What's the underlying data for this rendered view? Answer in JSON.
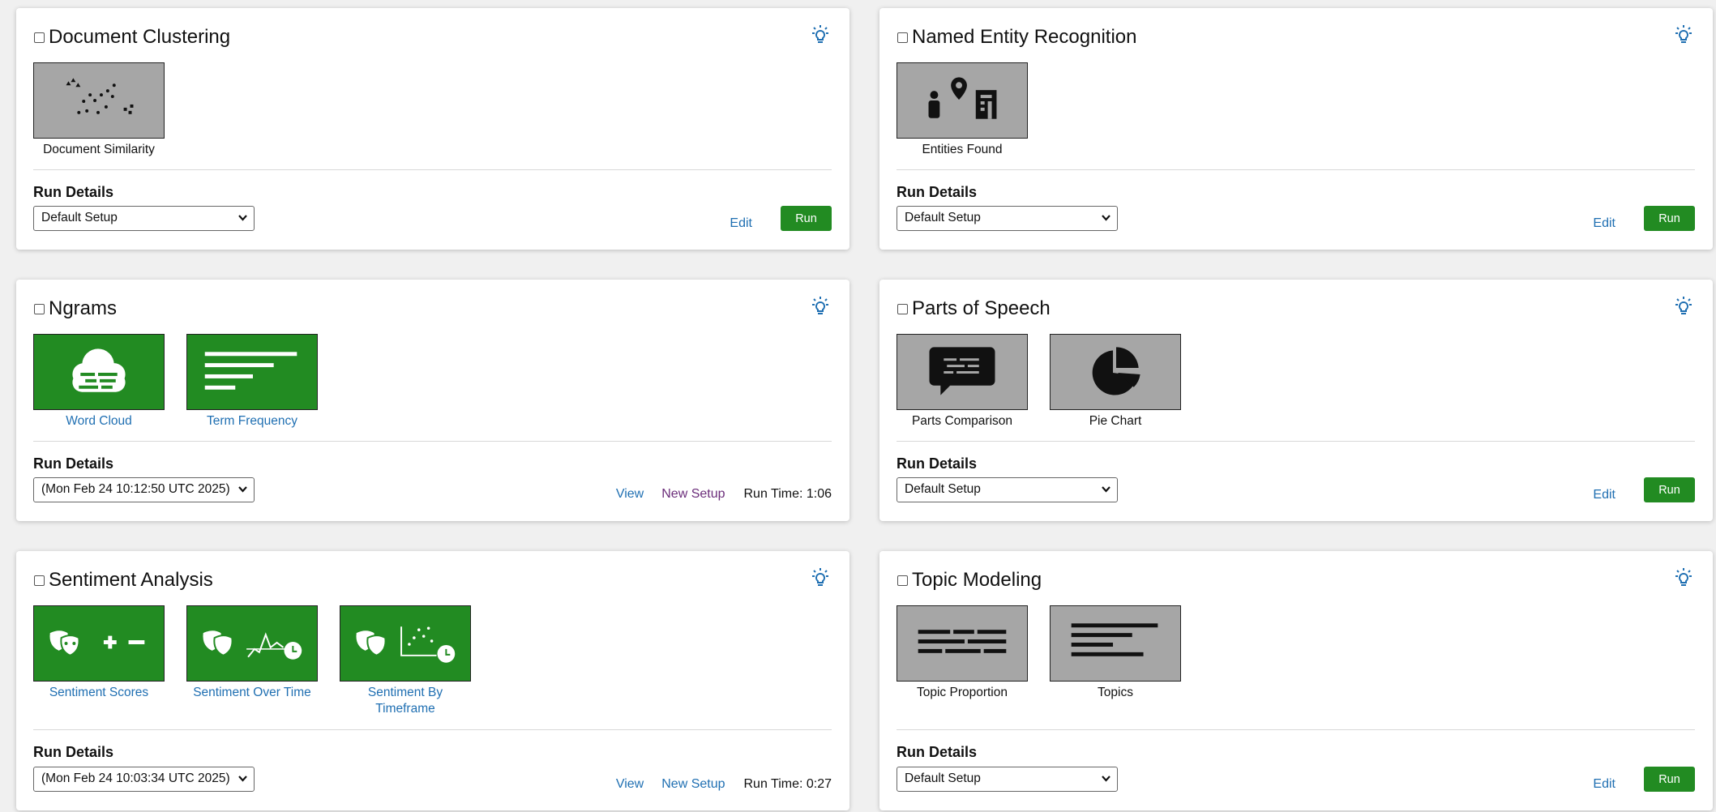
{
  "colors": {
    "accent_green": "#228b22",
    "link_blue": "#1f6fb2",
    "visited_purple": "#6b2d7a",
    "tile_gray": "#a6a6a6"
  },
  "cards": [
    {
      "title": "Document Clustering",
      "tiles": [
        {
          "label": "Document Similarity",
          "icon": "scatter-dots-icon"
        }
      ],
      "run_details_label": "Run Details",
      "select_value": "Default Setup",
      "edit_label": "Edit",
      "run_label": "Run"
    },
    {
      "title": "Named Entity Recognition",
      "tiles": [
        {
          "label": "Entities Found",
          "icon": "person-pin-building-icon"
        }
      ],
      "run_details_label": "Run Details",
      "select_value": "Default Setup",
      "edit_label": "Edit",
      "run_label": "Run"
    },
    {
      "title": "Ngrams",
      "tiles": [
        {
          "label": "Word Cloud",
          "icon": "word-cloud-icon"
        },
        {
          "label": "Term Frequency",
          "icon": "term-frequency-bars-icon"
        }
      ],
      "run_details_label": "Run Details",
      "select_value": "(Mon Feb 24 10:12:50 UTC 2025)",
      "view_label": "View",
      "new_setup_label": "New Setup",
      "run_time": "Run Time: 1:06"
    },
    {
      "title": "Parts of Speech",
      "tiles": [
        {
          "label": "Parts Comparison",
          "icon": "speech-bubble-icon"
        },
        {
          "label": "Pie Chart",
          "icon": "pie-chart-icon"
        }
      ],
      "run_details_label": "Run Details",
      "select_value": "Default Setup",
      "edit_label": "Edit",
      "run_label": "Run"
    },
    {
      "title": "Sentiment Analysis",
      "tiles": [
        {
          "label": "Sentiment Scores",
          "icon": "masks-plus-minus-icon"
        },
        {
          "label": "Sentiment Over Time",
          "icon": "masks-line-clock-icon"
        },
        {
          "label": "Sentiment By Timeframe",
          "icon": "masks-scatter-clock-icon"
        }
      ],
      "run_details_label": "Run Details",
      "select_value": "(Mon Feb 24 10:03:34 UTC 2025)",
      "view_label": "View",
      "new_setup_label": "New Setup",
      "run_time": "Run Time: 0:27"
    },
    {
      "title": "Topic Modeling",
      "tiles": [
        {
          "label": "Topic Proportion",
          "icon": "topic-proportion-icon"
        },
        {
          "label": "Topics",
          "icon": "topics-bars-icon"
        }
      ],
      "run_details_label": "Run Details",
      "select_value": "Default Setup",
      "edit_label": "Edit",
      "run_label": "Run"
    }
  ]
}
